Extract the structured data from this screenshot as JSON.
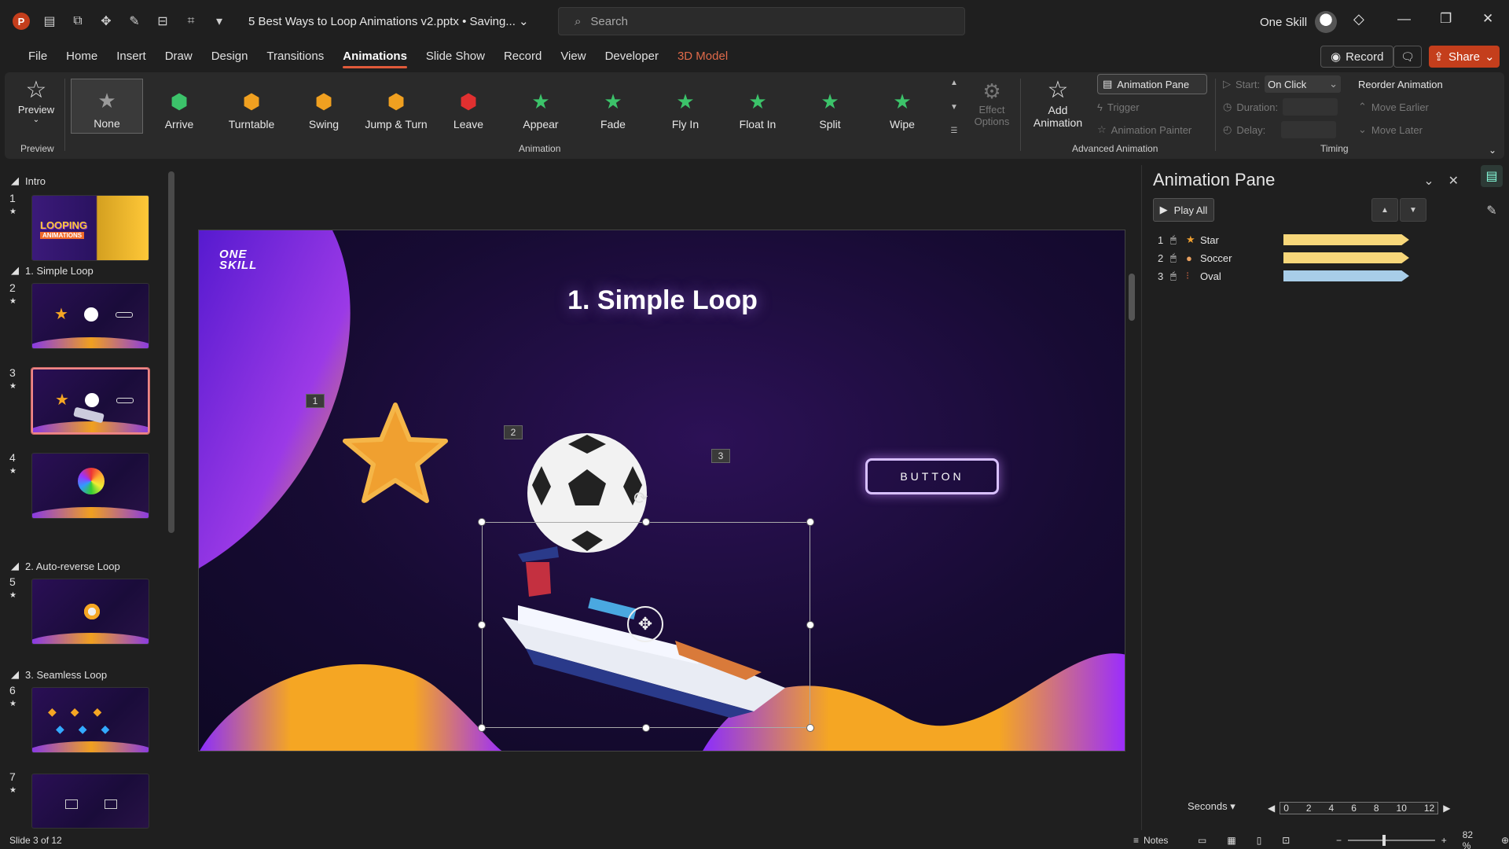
{
  "titlebar": {
    "doc_title": "5 Best Ways to Loop Animations v2.pptx • Saving...",
    "search_placeholder": "Search",
    "user_name": "One Skill"
  },
  "menu": {
    "tabs": [
      "File",
      "Home",
      "Insert",
      "Draw",
      "Design",
      "Transitions",
      "Animations",
      "Slide Show",
      "Record",
      "View",
      "Developer",
      "3D Model"
    ],
    "active": "Animations",
    "record_label": "Record",
    "share_label": "Share"
  },
  "ribbon": {
    "preview_label": "Preview",
    "preview_group": "Preview",
    "animation_group": "Animation",
    "animations": [
      {
        "label": "None",
        "icon": "star-outline-icon",
        "color": "#9a9a9a"
      },
      {
        "label": "Arrive",
        "icon": "arrive-icon",
        "color": "#3cc36a"
      },
      {
        "label": "Turntable",
        "icon": "turntable-icon",
        "color": "#f0a020"
      },
      {
        "label": "Swing",
        "icon": "swing-icon",
        "color": "#f0a020"
      },
      {
        "label": "Jump & Turn",
        "icon": "jump-turn-icon",
        "color": "#f0a020"
      },
      {
        "label": "Leave",
        "icon": "leave-icon",
        "color": "#e03030"
      },
      {
        "label": "Appear",
        "icon": "star-icon",
        "color": "#3cc36a"
      },
      {
        "label": "Fade",
        "icon": "star-icon",
        "color": "#3cc36a"
      },
      {
        "label": "Fly In",
        "icon": "star-icon",
        "color": "#3cc36a"
      },
      {
        "label": "Float In",
        "icon": "star-icon",
        "color": "#3cc36a"
      },
      {
        "label": "Split",
        "icon": "star-icon",
        "color": "#3cc36a"
      },
      {
        "label": "Wipe",
        "icon": "star-icon",
        "color": "#3cc36a"
      }
    ],
    "effect_options": "Effect Options",
    "add_animation": "Add Animation",
    "animation_pane_btn": "Animation Pane",
    "trigger": "Trigger",
    "animation_painter": "Animation Painter",
    "advanced_group": "Advanced Animation",
    "start_label": "Start:",
    "start_value": "On Click",
    "duration_label": "Duration:",
    "delay_label": "Delay:",
    "timing_group": "Timing",
    "reorder_title": "Reorder Animation",
    "move_earlier": "Move Earlier",
    "move_later": "Move Later"
  },
  "thumbnails": {
    "sections": [
      {
        "name": "Intro"
      },
      {
        "name": "1. Simple Loop"
      },
      {
        "name": "2. Auto-reverse Loop"
      },
      {
        "name": "3. Seamless Loop"
      }
    ],
    "slides": [
      {
        "num": "1"
      },
      {
        "num": "2"
      },
      {
        "num": "3"
      },
      {
        "num": "4"
      },
      {
        "num": "5"
      },
      {
        "num": "6"
      },
      {
        "num": "7"
      }
    ]
  },
  "slide": {
    "logo_line1": "ONE",
    "logo_line2": "SKILL",
    "title": "1. Simple Loop",
    "tag1": "1",
    "tag2": "2",
    "tag3": "3",
    "button_text": "BUTTON"
  },
  "anim_pane": {
    "title": "Animation Pane",
    "play_all": "Play All",
    "items": [
      {
        "num": "1",
        "name": "Star",
        "color": "#f7d77a",
        "fraction": 0.86
      },
      {
        "num": "2",
        "name": "Soccer",
        "color": "#f7d77a",
        "fraction": 0.86
      },
      {
        "num": "3",
        "name": "Oval",
        "color": "#a8cde8",
        "fraction": 0.86
      }
    ],
    "seconds_label": "Seconds",
    "ruler_ticks": [
      "0",
      "2",
      "4",
      "6",
      "8",
      "10",
      "12"
    ]
  },
  "status": {
    "slide_info": "Slide 3 of 12",
    "notes": "Notes",
    "zoom": "82 %"
  }
}
